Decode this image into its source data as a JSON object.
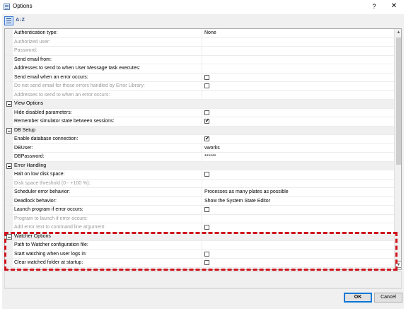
{
  "window": {
    "title": "Options",
    "help_label": "?",
    "close_label": "✕",
    "icon": "options-app-icon"
  },
  "toolbar": {
    "categorized_icon": "categorized-view-icon",
    "alpha_label": "A↓Z",
    "alpha_icon": "alphabetical-sort-icon"
  },
  "rows": [
    {
      "kind": "prop",
      "name": "Authentication type:",
      "value": "None"
    },
    {
      "kind": "prop",
      "name": "Authorized user:",
      "disabled": true
    },
    {
      "kind": "prop",
      "name": "Password:",
      "disabled": true
    },
    {
      "kind": "prop",
      "name": "Send email from:"
    },
    {
      "kind": "prop",
      "name": "Addresses to send to when User Message task executes:"
    },
    {
      "kind": "prop",
      "name": "Send email when an error occurs:",
      "checkbox": true,
      "checked": false
    },
    {
      "kind": "prop",
      "name": "Do not send email for those errors handled by Error Library:",
      "disabled": true,
      "checkbox": true,
      "checked": false
    },
    {
      "kind": "prop",
      "name": "Addresses to send to when an error occurs:",
      "disabled": true
    },
    {
      "kind": "cat",
      "name": "View Options"
    },
    {
      "kind": "prop",
      "name": "Hide disabled parameters:",
      "checkbox": true,
      "checked": false
    },
    {
      "kind": "prop",
      "name": "Remember simulator state between sessions:",
      "checkbox": true,
      "checked": true
    },
    {
      "kind": "cat",
      "name": "DB Setup"
    },
    {
      "kind": "prop",
      "name": "Enable database connection:",
      "checkbox": true,
      "checked": true
    },
    {
      "kind": "prop",
      "name": "DBUser:",
      "value": "vworks"
    },
    {
      "kind": "prop",
      "name": "DBPassword:",
      "value": "******"
    },
    {
      "kind": "cat",
      "name": "Error Handling"
    },
    {
      "kind": "prop",
      "name": "Halt on low disk space:",
      "checkbox": true,
      "checked": false
    },
    {
      "kind": "prop",
      "name": "Disk space threshold (0 - +100 %):",
      "disabled": true
    },
    {
      "kind": "prop",
      "name": "Scheduler error behavior:",
      "value": "Processes as many plates as possible"
    },
    {
      "kind": "prop",
      "name": "Deadlock behavior:",
      "value": "Show the System State Editor"
    },
    {
      "kind": "prop",
      "name": "Launch program if error occurs:",
      "checkbox": true,
      "checked": false
    },
    {
      "kind": "prop",
      "name": "Program to launch if error occurs:",
      "disabled": true
    },
    {
      "kind": "prop",
      "name": "Add error text to command line argument:",
      "disabled": true,
      "checkbox": true,
      "checked": false
    },
    {
      "kind": "cat",
      "name": "Watcher Options"
    },
    {
      "kind": "prop",
      "name": "Path to Watcher configuration file:"
    },
    {
      "kind": "prop",
      "name": "Start watching when user logs in:",
      "checkbox": true,
      "checked": false
    },
    {
      "kind": "prop",
      "name": "Clear watched folder at startup:",
      "checkbox": true,
      "checked": false
    }
  ],
  "scrollbar": {
    "up_label": "▲",
    "down_label": "▼"
  },
  "buttons": {
    "ok": "OK",
    "cancel": "Cancel"
  },
  "colors": {
    "highlight": "#d0121b",
    "focus": "#0078d7"
  }
}
